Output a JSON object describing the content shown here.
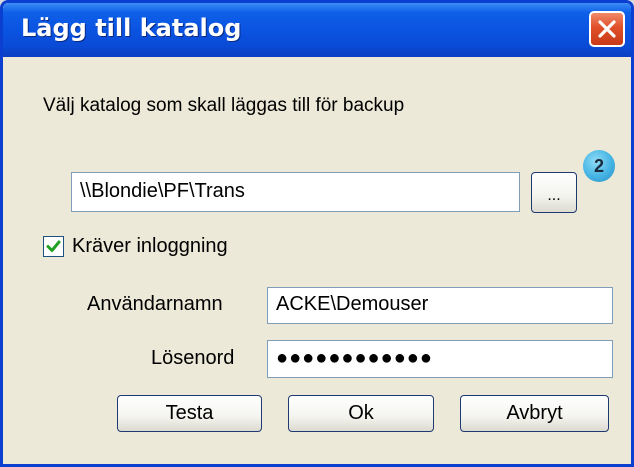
{
  "window": {
    "title": "Lägg till katalog",
    "close_icon": "close-icon"
  },
  "instruction": "Välj katalog som skall läggas till för backup",
  "path": {
    "value": "\\\\Blondie\\PF\\Trans",
    "browse_label": "..."
  },
  "step_badge": "2",
  "login": {
    "checked": true,
    "label": "Kräver inloggning"
  },
  "username": {
    "label": "Användarnamn",
    "value": "ACKE\\Demouser"
  },
  "password": {
    "label": "Lösenord",
    "value": "●●●●●●●●●●●●"
  },
  "buttons": {
    "test": "Testa",
    "ok": "Ok",
    "cancel": "Avbryt"
  },
  "colors": {
    "title_bar": "#0a52e0",
    "dialog_bg": "#ece9d8",
    "field_border": "#7f9db9",
    "close_red": "#e0502a",
    "badge_blue": "#45b4e4"
  }
}
